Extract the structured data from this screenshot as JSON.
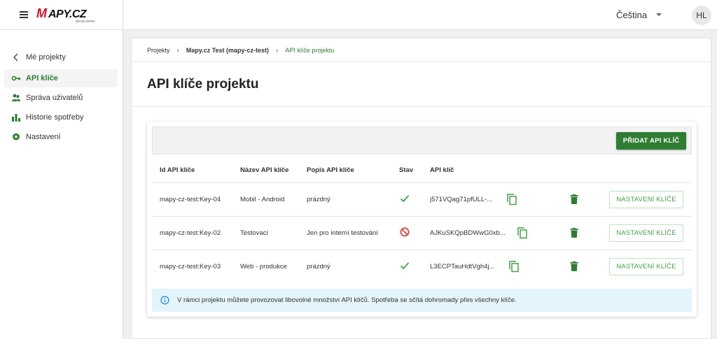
{
  "brand": {
    "logo_text": "MAPY.CZ",
    "logo_sub": "DEVELOPER",
    "menu_icon": "hamburger-icon"
  },
  "header": {
    "language": "Čeština",
    "avatar_initials": "HL"
  },
  "sidebar": {
    "back_label": "Mé projekty",
    "items": [
      {
        "label": "API klíče",
        "icon": "key-icon",
        "active": true
      },
      {
        "label": "Správa uživatelů",
        "icon": "users-icon",
        "active": false
      },
      {
        "label": "Historie spotřeby",
        "icon": "bar-chart-icon",
        "active": false
      },
      {
        "label": "Nastavení",
        "icon": "gear-icon",
        "active": false
      }
    ]
  },
  "breadcrumb": {
    "items": [
      "Projekty",
      "Mapy.cz Test (mapy-cz-test)",
      "API klíče projektu"
    ]
  },
  "page": {
    "title": "API klíče projektu"
  },
  "table": {
    "add_button": "PŘIDAT API KLÍČ",
    "columns": [
      "Id API klíče",
      "Název API klíče",
      "Popis API klíče",
      "Stav",
      "API klíč"
    ],
    "rows": [
      {
        "id": "mapy-cz-test:Key-04",
        "name": "Mobil - Android",
        "description": "prázdný",
        "status": "active",
        "key": "j571VQag71pfULL-...",
        "settings": "NASTAVENÍ KLÍČE"
      },
      {
        "id": "mapy-cz-test:Key-02",
        "name": "Testovací",
        "description": "Jen pro interní testování",
        "status": "disabled",
        "key": "AJKuSKQpBDWwG0xb...",
        "settings": "NASTAVENÍ KLÍČE"
      },
      {
        "id": "mapy-cz-test:Key-03",
        "name": "Web - produkce",
        "description": "prázdný",
        "status": "active",
        "key": "L3ECPTauHdtVgh4j...",
        "settings": "NASTAVENÍ KLÍČE"
      }
    ]
  },
  "info": {
    "text": "V rámci projektu můžete provozovat libovolné množství API klíčů. Spotřeba se sčítá dohromady přes všechny klíče."
  },
  "colors": {
    "accent": "#2e7d32",
    "active_status": "#43a047",
    "disabled_status": "#e53935",
    "logo_red": "#d4152c",
    "info_bg": "#e3f4fb"
  }
}
